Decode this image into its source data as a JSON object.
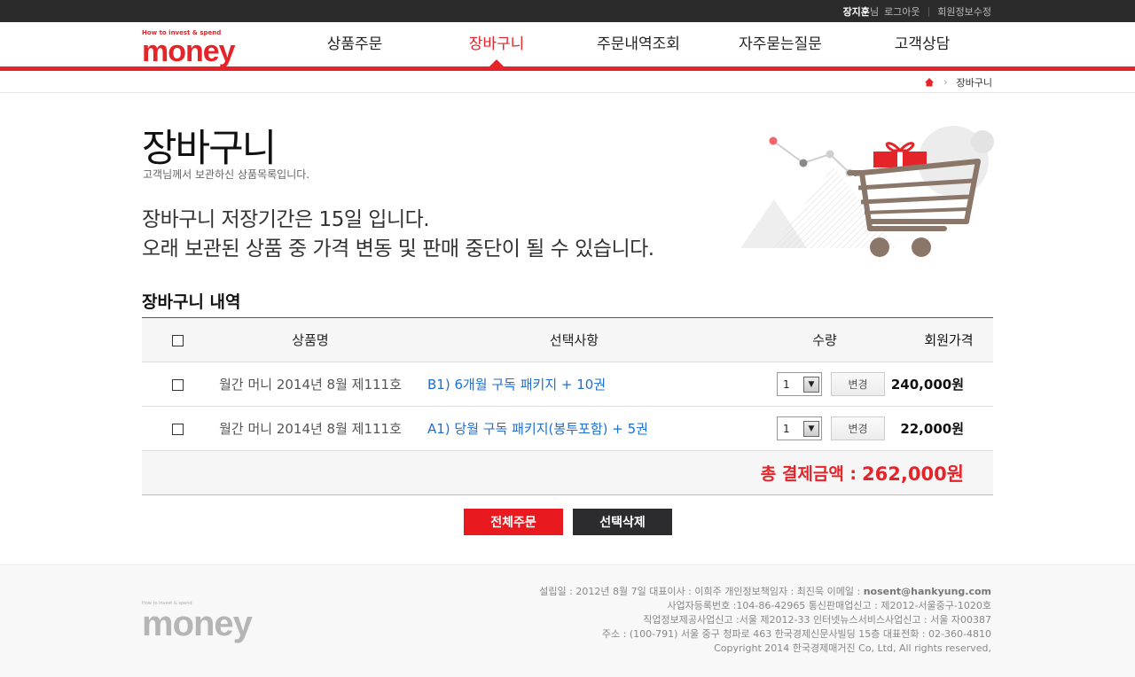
{
  "topbar": {
    "user_name": "장지훈",
    "user_suffix": "님",
    "logout": "로그아웃",
    "edit_profile": "회원정보수정"
  },
  "logo": {
    "tagline": "How to invest & spend",
    "word": "money"
  },
  "nav": [
    {
      "label": "상품주문"
    },
    {
      "label": "장바구니"
    },
    {
      "label": "주문내역조회"
    },
    {
      "label": "자주묻는질문"
    },
    {
      "label": "고객상담"
    }
  ],
  "breadcrumb": {
    "current": "장바구니"
  },
  "page": {
    "title": "장바구니",
    "subtitle": "고객님께서 보관하신 상품목록입니다.",
    "notice_line1": "장바구니 저장기간은 15일 입니다.",
    "notice_line2": "오래 보관된 상품 중 가격 변동 및 판매 중단이 될 수 있습니다."
  },
  "cart": {
    "section_title": "장바구니 내역",
    "columns": {
      "name": "상품명",
      "option": "선택사항",
      "qty": "수량",
      "price": "회원가격"
    },
    "items": [
      {
        "name": "월간 머니 2014년 8월 제111호",
        "option": "B1) 6개월 구독 패키지 + 10권",
        "qty": "1",
        "change": "변경",
        "price": "240,000원"
      },
      {
        "name": "월간 머니 2014년 8월 제111호",
        "option": "A1) 당월 구독 패키지(봉투포함) + 5권",
        "qty": "1",
        "change": "변경",
        "price": "22,000원"
      }
    ],
    "total_label": "총 결제금액 :",
    "total_amount": "262,000원"
  },
  "actions": {
    "order_all": "전체주문",
    "delete_selected": "선택삭제"
  },
  "footer": {
    "logo_tagline": "How to invest & spend",
    "logo_word": "money",
    "line1_prefix": "설립일 : 2012년 8월 7일 대표이사 : 이희주 개인정보책임자 : 최진욱 이메일 : ",
    "email": "nosent@hankyung.com",
    "line2": "사업자등록번호 :104-86-42965 통신판매업신고 : 제2012-서울중구-1020호",
    "line3": "직업정보제공사업신고 :서울 제2012-33 인터넷뉴스서비스사업신고 : 서울 자00387",
    "line4": "주소 : (100-791) 서울 중구 청파로 463 한국경제신문사빌딩 15층 대표전화 : 02-360-4810",
    "line5": "Copyright 2014 한국경제매거진 Co, Ltd, All rights reserved,"
  },
  "colors": {
    "brand_red": "#e52429",
    "link_blue": "#1e6fd1",
    "dark_button": "#2c2c2e",
    "topbar": "#2b2b2b"
  }
}
